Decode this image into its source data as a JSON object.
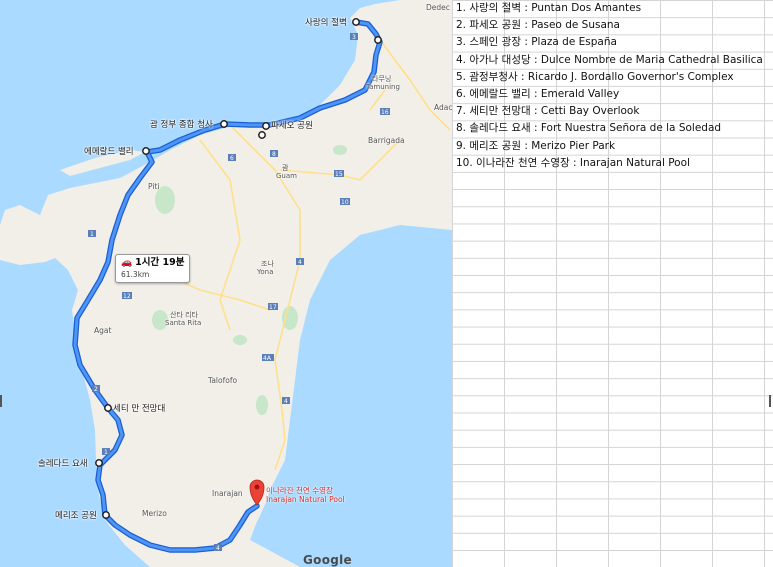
{
  "map": {
    "stops": [
      {
        "label": "사랑의 절벽"
      },
      {
        "label": "파세오 공원"
      },
      {
        "label": "괌 정부 종합 청사"
      },
      {
        "label": "에메랄드 밸리"
      },
      {
        "label": "세티 만 전망대"
      },
      {
        "label": "솔레다드 요새"
      },
      {
        "label": "메리조 공원"
      }
    ],
    "destination": {
      "label_ko": "이나라잔 천연 수영장",
      "label_en": "Inarajan Natural Pool"
    },
    "route_summary": {
      "duration": "1시간 19분",
      "distance": "61.3km"
    },
    "places": {
      "dededo": "Dedec",
      "tamuning_ko": "타무닝",
      "tamuning": "Tamuning",
      "adac": "Adac",
      "barrigada": "Barrigada",
      "guam_ko": "괌",
      "guam": "Guam",
      "piti": "Piti",
      "yona_ko": "조나",
      "yona": "Yona",
      "santarita_ko": "산타 리타",
      "santarita": "Santa Rita",
      "agat": "Agat",
      "talofofo": "Talofofo",
      "inarajan": "Inarajan",
      "merizo": "Merizo"
    },
    "route_numbers": [
      "3",
      "1",
      "16",
      "8",
      "6",
      "15",
      "10",
      "4",
      "17",
      "12",
      "4A",
      "2",
      "4",
      "1",
      "4"
    ],
    "attribution": "Google",
    "colors": {
      "water": "#aadaff",
      "land": "#f2efe9",
      "route": "#4285f4",
      "route_outline": "#1a5fd0",
      "park": "#c8e6c9",
      "pin": "#ea4335"
    }
  },
  "sheet": {
    "rows": [
      "1. 사랑의 절벽 : Puntan Dos Amantes",
      "2. 파세오 공원 : Paseo de Susana",
      "3. 스페인 광장 : Plaza de España",
      "4. 아가나 대성당 : Dulce Nombre de Maria Cathedral Basilica",
      "5. 괌정부청사 : Ricardo J. Bordallo Governor's Complex",
      "6. 에메랄드 밸리 : Emerald Valley",
      "7. 세티만 전망대 : Cetti Bay Overlook",
      "8. 솔레다드 요새 : Fort Nuestra Señora de la Soledad",
      "9. 메리조 공원 : Merizo Pier Park",
      "10. 이나라잔 천연 수영장 : Inarajan Natural Pool"
    ]
  }
}
